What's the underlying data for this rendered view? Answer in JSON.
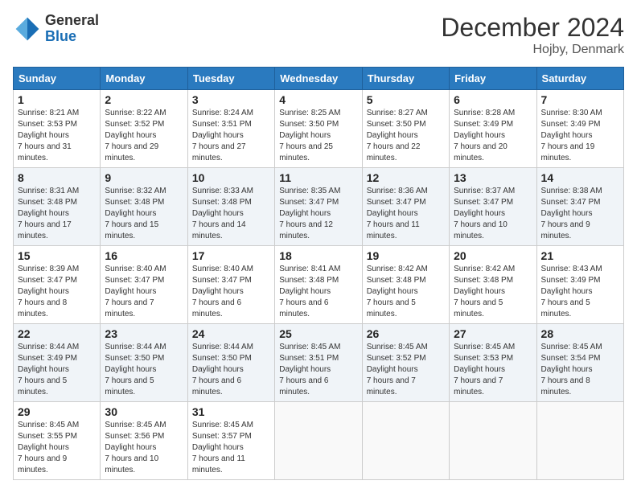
{
  "header": {
    "logo_general": "General",
    "logo_blue": "Blue",
    "month_title": "December 2024",
    "location": "Hojby, Denmark"
  },
  "weekdays": [
    "Sunday",
    "Monday",
    "Tuesday",
    "Wednesday",
    "Thursday",
    "Friday",
    "Saturday"
  ],
  "weeks": [
    [
      {
        "day": "1",
        "sunrise": "8:21 AM",
        "sunset": "3:53 PM",
        "daylight": "7 hours and 31 minutes."
      },
      {
        "day": "2",
        "sunrise": "8:22 AM",
        "sunset": "3:52 PM",
        "daylight": "7 hours and 29 minutes."
      },
      {
        "day": "3",
        "sunrise": "8:24 AM",
        "sunset": "3:51 PM",
        "daylight": "7 hours and 27 minutes."
      },
      {
        "day": "4",
        "sunrise": "8:25 AM",
        "sunset": "3:50 PM",
        "daylight": "7 hours and 25 minutes."
      },
      {
        "day": "5",
        "sunrise": "8:27 AM",
        "sunset": "3:50 PM",
        "daylight": "7 hours and 22 minutes."
      },
      {
        "day": "6",
        "sunrise": "8:28 AM",
        "sunset": "3:49 PM",
        "daylight": "7 hours and 20 minutes."
      },
      {
        "day": "7",
        "sunrise": "8:30 AM",
        "sunset": "3:49 PM",
        "daylight": "7 hours and 19 minutes."
      }
    ],
    [
      {
        "day": "8",
        "sunrise": "8:31 AM",
        "sunset": "3:48 PM",
        "daylight": "7 hours and 17 minutes."
      },
      {
        "day": "9",
        "sunrise": "8:32 AM",
        "sunset": "3:48 PM",
        "daylight": "7 hours and 15 minutes."
      },
      {
        "day": "10",
        "sunrise": "8:33 AM",
        "sunset": "3:48 PM",
        "daylight": "7 hours and 14 minutes."
      },
      {
        "day": "11",
        "sunrise": "8:35 AM",
        "sunset": "3:47 PM",
        "daylight": "7 hours and 12 minutes."
      },
      {
        "day": "12",
        "sunrise": "8:36 AM",
        "sunset": "3:47 PM",
        "daylight": "7 hours and 11 minutes."
      },
      {
        "day": "13",
        "sunrise": "8:37 AM",
        "sunset": "3:47 PM",
        "daylight": "7 hours and 10 minutes."
      },
      {
        "day": "14",
        "sunrise": "8:38 AM",
        "sunset": "3:47 PM",
        "daylight": "7 hours and 9 minutes."
      }
    ],
    [
      {
        "day": "15",
        "sunrise": "8:39 AM",
        "sunset": "3:47 PM",
        "daylight": "7 hours and 8 minutes."
      },
      {
        "day": "16",
        "sunrise": "8:40 AM",
        "sunset": "3:47 PM",
        "daylight": "7 hours and 7 minutes."
      },
      {
        "day": "17",
        "sunrise": "8:40 AM",
        "sunset": "3:47 PM",
        "daylight": "7 hours and 6 minutes."
      },
      {
        "day": "18",
        "sunrise": "8:41 AM",
        "sunset": "3:48 PM",
        "daylight": "7 hours and 6 minutes."
      },
      {
        "day": "19",
        "sunrise": "8:42 AM",
        "sunset": "3:48 PM",
        "daylight": "7 hours and 5 minutes."
      },
      {
        "day": "20",
        "sunrise": "8:42 AM",
        "sunset": "3:48 PM",
        "daylight": "7 hours and 5 minutes."
      },
      {
        "day": "21",
        "sunrise": "8:43 AM",
        "sunset": "3:49 PM",
        "daylight": "7 hours and 5 minutes."
      }
    ],
    [
      {
        "day": "22",
        "sunrise": "8:44 AM",
        "sunset": "3:49 PM",
        "daylight": "7 hours and 5 minutes."
      },
      {
        "day": "23",
        "sunrise": "8:44 AM",
        "sunset": "3:50 PM",
        "daylight": "7 hours and 5 minutes."
      },
      {
        "day": "24",
        "sunrise": "8:44 AM",
        "sunset": "3:50 PM",
        "daylight": "7 hours and 6 minutes."
      },
      {
        "day": "25",
        "sunrise": "8:45 AM",
        "sunset": "3:51 PM",
        "daylight": "7 hours and 6 minutes."
      },
      {
        "day": "26",
        "sunrise": "8:45 AM",
        "sunset": "3:52 PM",
        "daylight": "7 hours and 7 minutes."
      },
      {
        "day": "27",
        "sunrise": "8:45 AM",
        "sunset": "3:53 PM",
        "daylight": "7 hours and 7 minutes."
      },
      {
        "day": "28",
        "sunrise": "8:45 AM",
        "sunset": "3:54 PM",
        "daylight": "7 hours and 8 minutes."
      }
    ],
    [
      {
        "day": "29",
        "sunrise": "8:45 AM",
        "sunset": "3:55 PM",
        "daylight": "7 hours and 9 minutes."
      },
      {
        "day": "30",
        "sunrise": "8:45 AM",
        "sunset": "3:56 PM",
        "daylight": "7 hours and 10 minutes."
      },
      {
        "day": "31",
        "sunrise": "8:45 AM",
        "sunset": "3:57 PM",
        "daylight": "7 hours and 11 minutes."
      },
      null,
      null,
      null,
      null
    ]
  ]
}
